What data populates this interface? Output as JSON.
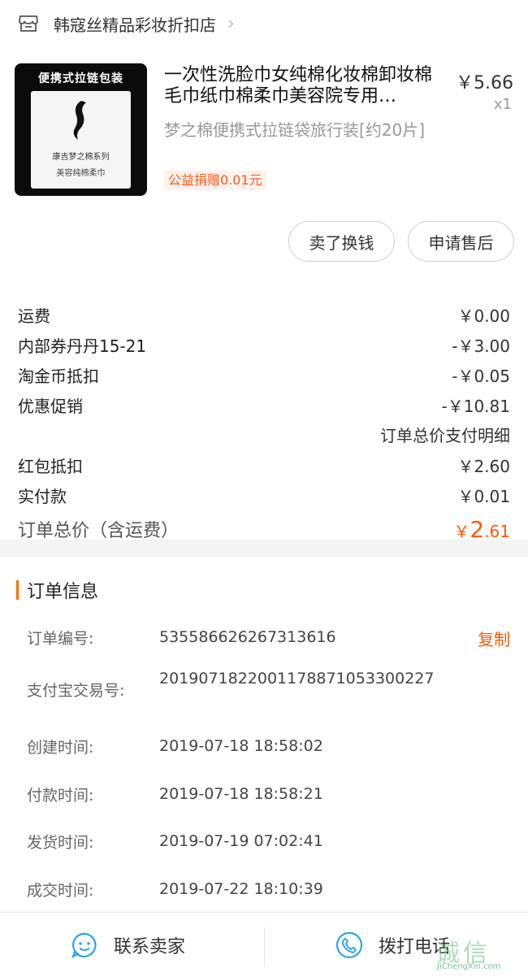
{
  "store": {
    "name": "韩寇丝精品彩妆折扣店",
    "icon": "store-icon",
    "chevron_icon": "chevron-right-icon"
  },
  "product": {
    "title": "一次性洗脸巾女纯棉化妆棉卸妆棉毛巾纸巾棉柔巾美容院专用…",
    "sku": "梦之棉便携式拉链袋旅行装[约20片]",
    "tag": "公益捐赠0.01元",
    "price": "￥5.66",
    "quantity": "x1",
    "thumb": {
      "top_text": "便携式拉链包装",
      "line1": "康吉梦之棉系列",
      "line2": "美容纯棉柔巾"
    }
  },
  "actions": {
    "sell": "卖了换钱",
    "after_sale": "申请售后"
  },
  "fees": [
    {
      "label": "运费",
      "value": "￥0.00"
    },
    {
      "label": "内部券丹丹15-21",
      "value": "-￥3.00"
    },
    {
      "label": "淘金币抵扣",
      "value": "-￥0.05"
    },
    {
      "label": "优惠促销",
      "value": "-￥10.81"
    }
  ],
  "payment_detail_link": "订单总价支付明细",
  "fees2": [
    {
      "label": "红包抵扣",
      "value": "￥2.60"
    },
    {
      "label": "实付款",
      "value": "￥0.01"
    }
  ],
  "total": {
    "label": "订单总价（含运费）",
    "currency": "￥",
    "int_part": "2",
    "dec_part": ".61"
  },
  "order_info": {
    "title": "订单信息",
    "copy": "复制",
    "rows": [
      {
        "label": "订单编号:",
        "value": "535586626267313616"
      },
      {
        "label": "支付宝交易号:",
        "value": "2019071822001178871053300227"
      },
      {
        "label": "创建时间:",
        "value": "2019-07-18 18:58:02"
      },
      {
        "label": "付款时间:",
        "value": "2019-07-18 18:58:21"
      },
      {
        "label": "发货时间:",
        "value": "2019-07-19 07:02:41"
      },
      {
        "label": "成交时间:",
        "value": "2019-07-22 18:10:39"
      }
    ]
  },
  "bottom_bar": {
    "contact_seller": "联系卖家",
    "call": "拨打电话",
    "contact_icon": "chat-face-icon",
    "call_icon": "phone-icon"
  },
  "watermark": {
    "main": "诚信",
    "sub": "JiChengXin.com"
  },
  "colors": {
    "accent": "#ff5a00",
    "muted": "#999999"
  }
}
